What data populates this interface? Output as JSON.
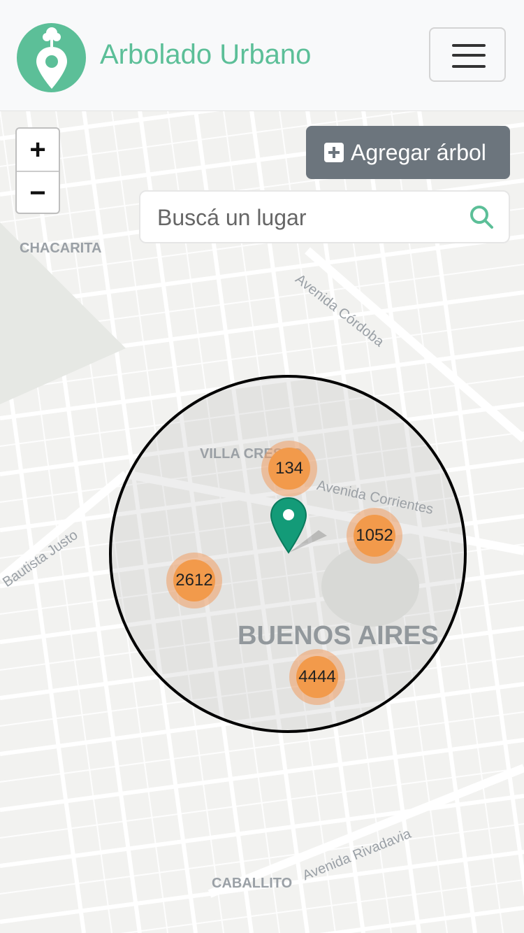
{
  "header": {
    "brand": "Arbolado Urbano"
  },
  "toolbar": {
    "add_label": "Agregar árbol"
  },
  "search": {
    "placeholder": "Buscá un lugar"
  },
  "zoom": {
    "in": "+",
    "out": "−"
  },
  "map": {
    "labels": {
      "chacarita": "CHACARITA",
      "villa_crespo": "VILLA CRESPO",
      "buenos_aires": "BUENOS AIRES",
      "caballito": "CABALLITO",
      "av_cordoba": "Avenida Córdoba",
      "av_corrientes": "Avenida Corrientes",
      "av_rivadavia": "Avenida Rivadavia",
      "juan_b_justo": "Bautista Justo"
    },
    "clusters": [
      {
        "count": "134"
      },
      {
        "count": "1052"
      },
      {
        "count": "2612"
      },
      {
        "count": "4444"
      }
    ]
  },
  "colors": {
    "brand": "#5cbf98",
    "cluster": "#f29a4b",
    "button": "#6c757d"
  }
}
